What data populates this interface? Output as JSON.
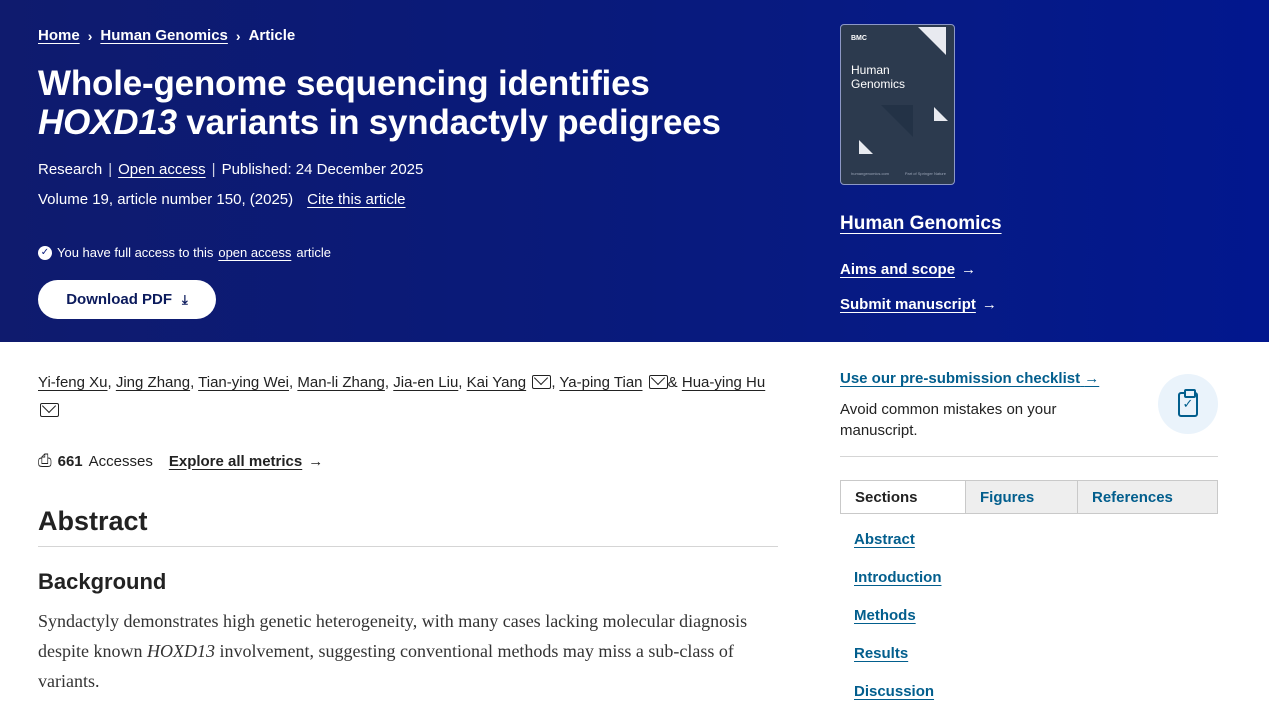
{
  "breadcrumb": {
    "home": "Home",
    "journal": "Human Genomics",
    "current": "Article",
    "separator": "›"
  },
  "article": {
    "title_part1": "Whole-genome sequencing identifies ",
    "title_italic": "HOXD13",
    "title_part2": " variants in syndactyly pedigrees",
    "type": "Research",
    "open_access": "Open access",
    "published": "Published: 24 December 2025",
    "volume": "Volume 19, article number 150, (2025)",
    "cite": "Cite this article",
    "access_prefix": "You have full access to this",
    "access_link": "open access",
    "access_suffix": "article",
    "download_label": "Download PDF"
  },
  "journal": {
    "name": "Human Genomics",
    "cover_brand": "BMC",
    "cover_title_line1": "Human",
    "cover_title_line2": "Genomics",
    "cover_footer_left": "humangenomics.com",
    "cover_footer_right": "Part of Springer Nature",
    "aims_link": "Aims and scope",
    "submit_link": "Submit manuscript"
  },
  "authors": {
    "a1": "Yi-feng Xu",
    "a2": "Jing Zhang",
    "a3": "Tian-ying Wei",
    "a4": "Man-li Zhang",
    "a5": "Jia-en Liu",
    "a6": "Kai Yang",
    "a7": "Ya-ping Tian",
    "a8": "Hua-ying Hu"
  },
  "metrics": {
    "count": "661",
    "label": "Accesses",
    "explore": "Explore all metrics"
  },
  "abstract": {
    "heading": "Abstract",
    "background_heading": "Background",
    "bg_text1": "Syndactyly demonstrates high genetic heterogeneity, with many cases lacking molecular diagnosis despite known ",
    "bg_italic": "HOXD13",
    "bg_text2": " involvement, suggesting conventional methods may miss a sub-class of variants."
  },
  "sidebar": {
    "checklist_link": "Use our pre-submission checklist",
    "checklist_text": "Avoid common mistakes on your manuscript.",
    "tabs": [
      "Sections",
      "Figures",
      "References"
    ],
    "sections": [
      "Abstract",
      "Introduction",
      "Methods",
      "Results",
      "Discussion"
    ]
  },
  "colors": {
    "hero_bg": "#091a7a",
    "link": "#025e8d",
    "text": "#222222"
  }
}
